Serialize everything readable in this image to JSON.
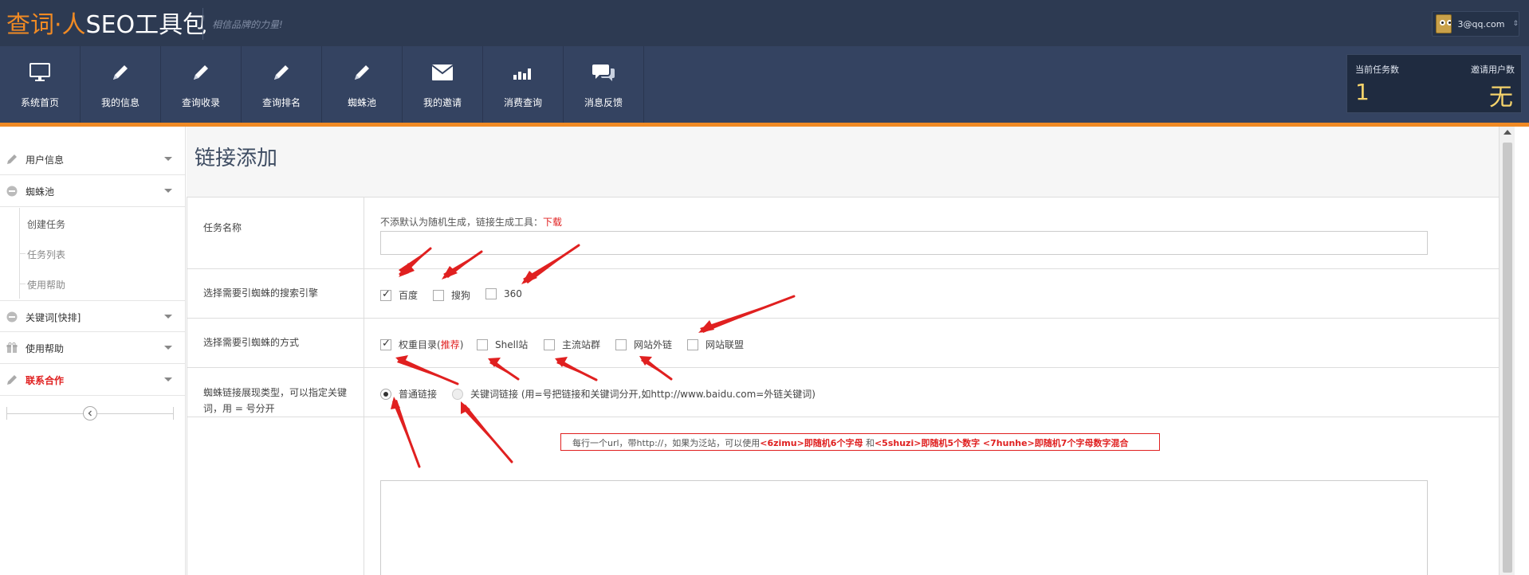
{
  "header": {
    "logo_part1": "查词·人",
    "logo_part2": "SEO工具包",
    "slogan": "相信品牌的力量!",
    "user_email": "3@qq.com",
    "user_caret": "⇕"
  },
  "nav": {
    "items": [
      {
        "label": "系统首页",
        "icon": "monitor-icon"
      },
      {
        "label": "我的信息",
        "icon": "pencil-icon"
      },
      {
        "label": "查询收录",
        "icon": "pencil-icon"
      },
      {
        "label": "查询排名",
        "icon": "pencil-icon"
      },
      {
        "label": "蜘蛛池",
        "icon": "pencil-icon"
      },
      {
        "label": "我的邀请",
        "icon": "envelope-icon"
      },
      {
        "label": "消费查询",
        "icon": "bar-chart-icon"
      },
      {
        "label": "消息反馈",
        "icon": "chat-icon"
      }
    ],
    "stats": {
      "task_label": "当前任务数",
      "task_value": "1",
      "invite_label": "邀请用户数",
      "invite_value": "无"
    }
  },
  "sidebar": {
    "items": [
      {
        "label": "用户信息",
        "icon": "pencil-icon"
      },
      {
        "label": "蜘蛛池",
        "icon": "minus-circle-icon"
      },
      {
        "label": "关键词[快排]",
        "icon": "minus-circle-icon"
      },
      {
        "label": "使用帮助",
        "icon": "gift-icon"
      },
      {
        "label": "联系合作",
        "icon": "pencil-icon"
      }
    ],
    "subitems": [
      "创建任务",
      "任务列表",
      "使用帮助"
    ],
    "collapse_icon": "chevron-left-icon"
  },
  "page": {
    "title": "链接添加"
  },
  "form": {
    "task_name": {
      "label": "任务名称",
      "hint": "不添默认为随机生成，链接生成工具：",
      "hint_link": "下载",
      "value": ""
    },
    "engines": {
      "label": "选择需要引蜘蛛的搜索引擎",
      "options": [
        {
          "label": "百度",
          "checked": true
        },
        {
          "label": "搜狗",
          "checked": false
        },
        {
          "label": "360",
          "checked": false
        }
      ]
    },
    "methods": {
      "label": "选择需要引蜘蛛的方式",
      "opt1_label": "权重目录(",
      "opt1_tag": "推荐",
      "opt1_close": ")",
      "options": [
        {
          "label": "Shell站",
          "checked": false
        },
        {
          "label": "主流站群",
          "checked": false
        },
        {
          "label": "网站外链",
          "checked": false
        },
        {
          "label": "网站联盟",
          "checked": false
        }
      ]
    },
    "link_type": {
      "label_line1": "蜘蛛链接展现类型，可以指定关键",
      "label_line2": "词，用 = 号分开",
      "options": [
        {
          "label": "普通链接",
          "checked": true
        },
        {
          "label": "关键词链接 (用=号把链接和关键词分开,如http://www.baidu.com=外链关键词)",
          "checked": false
        }
      ]
    },
    "urls": {
      "note_prefix": "每行一个url，带http://，如果为泛站，可以使用",
      "note_b1": "<6zimu>即随机6个字母",
      "note_mid": " 和",
      "note_b2": "<5shuzi>即随机5个数字 <7hunhe>即随机7个字母数字混合",
      "value": ""
    }
  },
  "colors": {
    "topbar": "#2d3a52",
    "navbar": "#344361",
    "accent": "#f08a24",
    "highlight": "#e02020"
  }
}
